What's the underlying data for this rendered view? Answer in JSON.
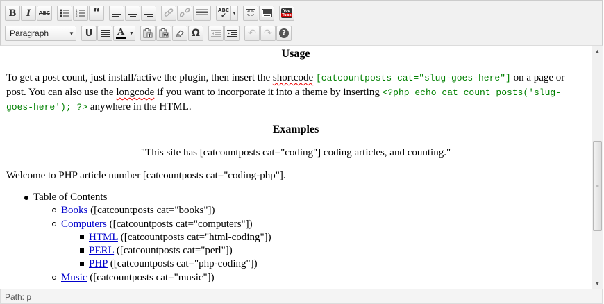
{
  "toolbar": {
    "row1": [
      {
        "name": "bold-button",
        "label": "B"
      },
      {
        "name": "italic-button",
        "label": "I"
      },
      {
        "name": "strikethrough-button",
        "label": "ABC"
      },
      {
        "name": "bullet-list-button",
        "icon": "bullet-list-icon"
      },
      {
        "name": "numbered-list-button",
        "icon": "numbered-list-icon"
      },
      {
        "name": "blockquote-button",
        "label": "“"
      },
      {
        "name": "align-left-button",
        "icon": "align-left-icon"
      },
      {
        "name": "align-center-button",
        "icon": "align-center-icon"
      },
      {
        "name": "align-right-button",
        "icon": "align-right-icon"
      },
      {
        "name": "insert-link-button",
        "icon": "link-icon"
      },
      {
        "name": "unlink-button",
        "icon": "unlink-icon"
      },
      {
        "name": "insert-more-button",
        "icon": "more-tag-icon"
      },
      {
        "name": "spellcheck-button",
        "label": "ABC"
      },
      {
        "name": "fullscreen-button",
        "icon": "fullscreen-icon"
      },
      {
        "name": "kitchen-sink-button",
        "icon": "keyboard-icon"
      },
      {
        "name": "youtube-button",
        "label": "You Tube"
      }
    ],
    "format_select": "Paragraph",
    "underline_label": "U",
    "text_color_label": "A",
    "omega_label": "Ω"
  },
  "content": {
    "usage_heading": "Usage",
    "usage_p1_a": "To get a post count, just install/active the plugin, then insert the ",
    "shortcode_word": "shortcode",
    "shortcode_code": "[catcountposts cat=\"slug-goes-here\"]",
    "usage_p1_b": " on a page or post. You can also use the ",
    "longcode_word": "longcode",
    "usage_p1_c": " if you want to incorporate it into a theme by inserting ",
    "php_code": "<?php echo cat_count_posts('slug-goes-here'); ?>",
    "usage_p1_d": " anywhere in the HTML.",
    "examples_heading": "Examples",
    "quote": "\"This site has [catcountposts cat=\"coding\"] coding articles, and counting.\"",
    "welcome": "Welcome to PHP article number [catcountposts cat=\"coding-php\"].",
    "toc": "Table of Contents",
    "books_link": "Books",
    "books_rest": " ([catcountposts cat=\"books\"])",
    "computers_link": "Computers",
    "computers_rest": " ([catcountposts cat=\"computers\"])",
    "html_link": "HTML",
    "html_rest": " ([catcountposts cat=\"html-coding\"])",
    "perl_link": "PERL",
    "perl_rest": " ([catcountposts cat=\"perl\"])",
    "php_link": "PHP",
    "php_rest": " ([catcountposts cat=\"php-coding\"])",
    "music_link": "Music",
    "music_rest": " ([catcountposts cat=\"music\"])"
  },
  "status": {
    "path": "Path: p"
  }
}
